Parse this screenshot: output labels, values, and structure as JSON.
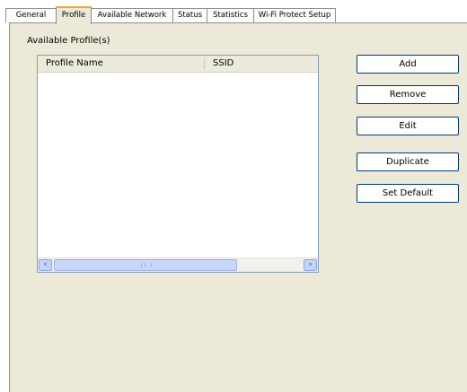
{
  "tabs": [
    {
      "label": "General",
      "active": false
    },
    {
      "label": "Profile",
      "active": true
    },
    {
      "label": "Available Network",
      "active": false
    },
    {
      "label": "Status",
      "active": false
    },
    {
      "label": "Statistics",
      "active": false
    },
    {
      "label": "Wi-Fi Protect Setup",
      "active": false
    }
  ],
  "profiles": {
    "section_label": "Available Profile(s)",
    "columns": [
      "Profile Name",
      "SSID"
    ],
    "rows": []
  },
  "buttons": {
    "add": "Add",
    "remove": "Remove",
    "edit": "Edit",
    "duplicate": "Duplicate",
    "set_default": "Set Default"
  },
  "colors": {
    "panel_bg": "#ece9d8",
    "active_tab_accent": "#f5a623",
    "button_border": "#003c74"
  }
}
